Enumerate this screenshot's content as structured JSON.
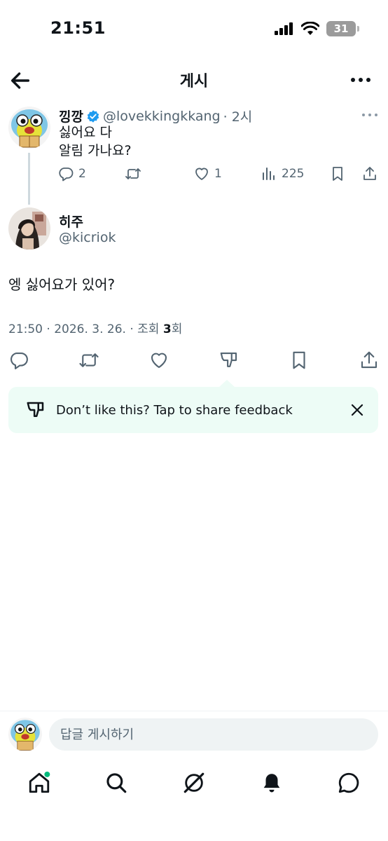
{
  "status": {
    "time": "21:51",
    "battery": "31"
  },
  "header": {
    "title": "게시"
  },
  "parent_post": {
    "name": "낑깡",
    "handle": "@lovekkingkkang",
    "time": "· 2시",
    "text": "싫어요 다\n알림 가나요?",
    "replies": "2",
    "likes": "1",
    "views": "225"
  },
  "reply": {
    "name": "히주",
    "handle": "@kicriok",
    "text": "엥 싫어요가 있어?",
    "meta_prefix": "21:50 · 2026. 3. 26. · 조회 ",
    "views": "3",
    "meta_suffix": "회"
  },
  "feedback": {
    "text": "Don’t like this? Tap to share feedback"
  },
  "compose": {
    "placeholder": "답글 게시하기"
  },
  "colors": {
    "accent": "#1d9bf0",
    "feedback_bg": "#edfcf6",
    "muted": "#536471",
    "notify_dot": "#00ba7c"
  },
  "icons": [
    "back-arrow-icon",
    "more-icon",
    "verified-icon",
    "reply-icon",
    "retweet-icon",
    "like-icon",
    "views-icon",
    "bookmark-icon",
    "share-icon",
    "dislike-icon",
    "close-icon",
    "home-icon",
    "search-icon",
    "grok-icon",
    "bell-icon",
    "messages-icon"
  ]
}
